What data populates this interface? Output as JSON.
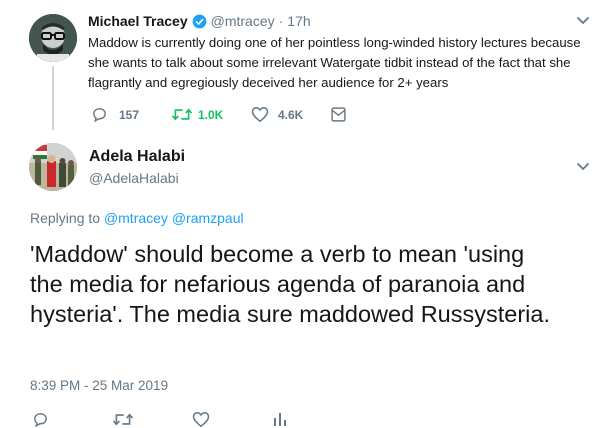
{
  "colors": {
    "accent": "#1da1f2",
    "muted": "#657786",
    "text": "#14171a",
    "retweet": "#17bf63",
    "verified": "#1da1f2"
  },
  "parent_tweet": {
    "author_name": "Michael Tracey",
    "handle": "@mtracey",
    "separator": "·",
    "time": "17h",
    "text": "Maddow is currently doing one of her pointless long-winded history lectures because she wants to talk about some irrelevant Watergate tidbit instead of the fact that she flagrantly and egregiously deceived her audience for 2+ years",
    "stats": {
      "replies": "157",
      "retweets": "1.0K",
      "likes": "4.6K"
    },
    "icons": [
      "reply-icon",
      "retweet-icon",
      "like-icon",
      "message-icon",
      "chevron-down-icon",
      "verified-badge-icon"
    ]
  },
  "main_tweet": {
    "author_name": "Adela Halabi",
    "handle": "@AdelaHalabi",
    "replying_to_label": "Replying to",
    "replying_to_1": "@mtracey",
    "replying_to_2": "@ramzpaul",
    "text": "'Maddow' should become a verb to mean 'using the media for nefarious agenda of paranoia and hysteria'. The media sure maddowed Russysteria.",
    "timestamp": "8:39 PM - 25 Mar 2019",
    "icons": [
      "reply-icon",
      "retweet-icon",
      "like-icon",
      "analytics-icon",
      "chevron-down-icon"
    ]
  }
}
